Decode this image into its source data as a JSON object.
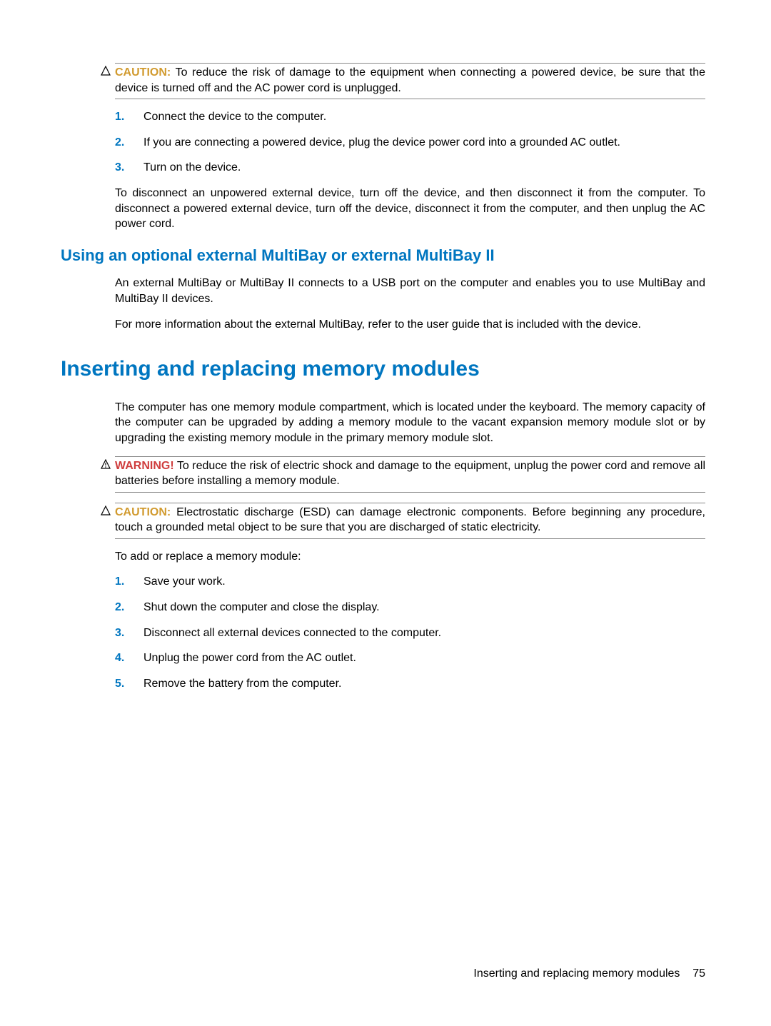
{
  "notice1": {
    "label": "CAUTION:",
    "text": "To reduce the risk of damage to the equipment when connecting a powered device, be sure that the device is turned off and the AC power cord is unplugged."
  },
  "steps1": [
    "Connect the device to the computer.",
    "If you are connecting a powered device, plug the device power cord into a grounded AC outlet.",
    "Turn on the device."
  ],
  "para_disconnect": "To disconnect an unpowered external device, turn off the device, and then disconnect it from the computer. To disconnect a powered external device, turn off the device, disconnect it from the computer, and then unplug the AC power cord.",
  "heading_multibay": "Using an optional external MultiBay or external MultiBay II",
  "para_multibay1": "An external MultiBay or MultiBay II connects to a USB port on the computer and enables you to use MultiBay and MultiBay II devices.",
  "para_multibay2": "For more information about the external MultiBay, refer to the user guide that is included with the device.",
  "heading_memory": "Inserting and replacing memory modules",
  "para_memory": "The computer has one memory module compartment, which is located under the keyboard. The memory capacity of the computer can be upgraded by adding a memory module to the vacant expansion memory module slot or by upgrading the existing memory module in the primary memory module slot.",
  "notice2": {
    "label": "WARNING!",
    "text": "To reduce the risk of electric shock and damage to the equipment, unplug the power cord and remove all batteries before installing a memory module."
  },
  "notice3": {
    "label": "CAUTION:",
    "text": "Electrostatic discharge (ESD) can damage electronic components. Before beginning any procedure, touch a grounded metal object to be sure that you are discharged of static electricity."
  },
  "para_addreplace": "To add or replace a memory module:",
  "steps2": [
    "Save your work.",
    "Shut down the computer and close the display.",
    "Disconnect all external devices connected to the computer.",
    "Unplug the power cord from the AC outlet.",
    "Remove the battery from the computer."
  ],
  "footer_text": "Inserting and replacing memory modules",
  "page_number": "75"
}
